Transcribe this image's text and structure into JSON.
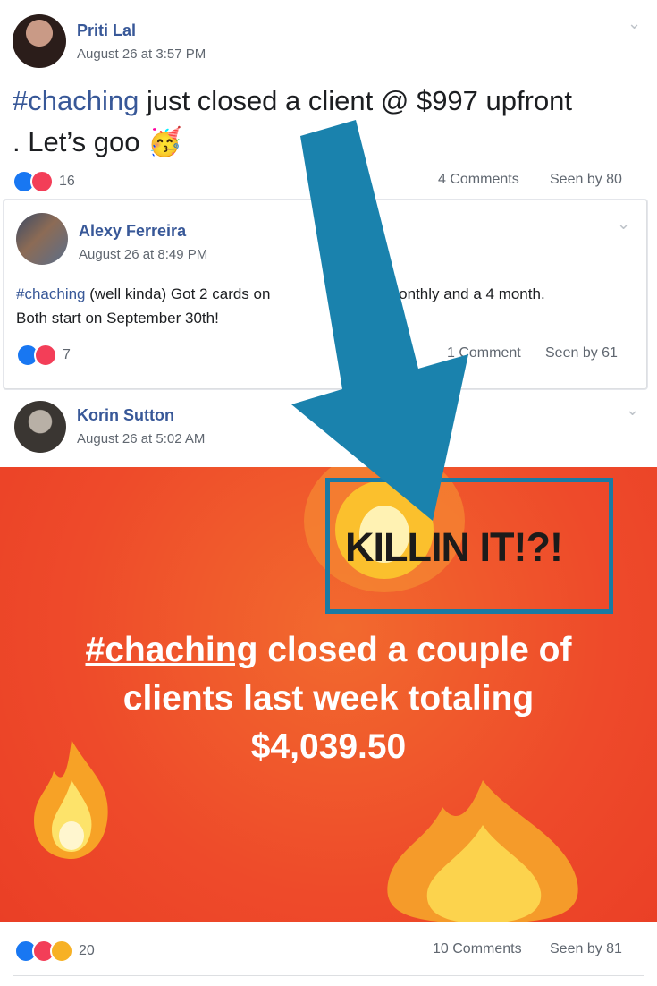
{
  "post1": {
    "author": "Priti Lal",
    "timestamp": "August 26 at 3:57 PM",
    "hashtag": "#chaching",
    "text_line1": " just closed a client @ $997 upfront",
    "text_line2": ". Let’s goo 🥳",
    "reactions_count": "16",
    "comments": "4 Comments",
    "seen_by": "Seen by 80"
  },
  "post2": {
    "author": "Alexy Ferreira",
    "timestamp": "August 26 at 8:49 PM",
    "hashtag": "#chaching",
    "text_line1a": " (well kinda) Got 2 cards on",
    "text_line1b": "monthly and a 4 month.",
    "text_line2": "Both start on September 30th!",
    "reactions_count": "7",
    "comments": "1 Comment",
    "seen_by": "Seen by 61"
  },
  "post3": {
    "author": "Korin Sutton",
    "timestamp": "August 26 at 5:02 AM",
    "banner": {
      "hashtag": "#chaching",
      "line1_rest": " closed a couple of",
      "line2": "clients last week totaling",
      "line3": "$4,039.50"
    },
    "reactions_count": "20",
    "comments": "10 Comments",
    "seen_by": "Seen by 81"
  },
  "annotation": {
    "label": "KILLIN IT!?!",
    "arrow_color": "#1a82ad",
    "box_color": "#1a7aa3"
  },
  "colors": {
    "link": "#385898",
    "banner": "#ee4a2a",
    "like": "#1877f2",
    "love": "#f33e58"
  }
}
